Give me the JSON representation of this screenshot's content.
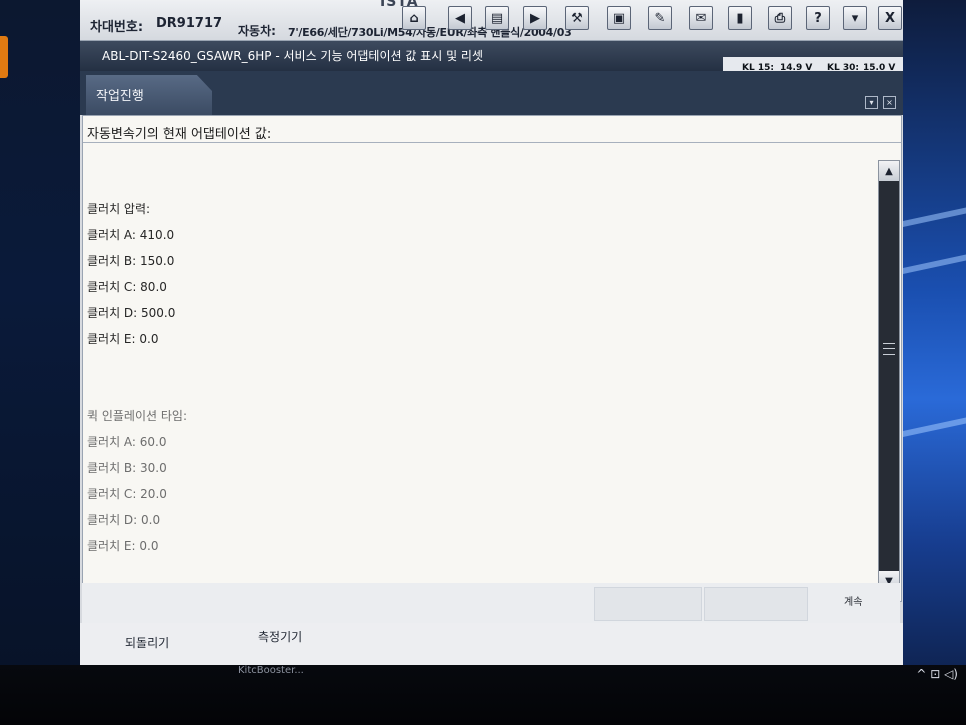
{
  "app": {
    "logo_partial": "ISTA"
  },
  "vehicle": {
    "vin_label": "차대번호:",
    "vin_value": "DR91717",
    "car_label": "자동차:",
    "car_value": "7'/E66/세단/730Li/M54/자동/EUR/좌측 핸들식/2004/03"
  },
  "toolbar": {
    "icons": [
      "home-icon",
      "arrow-left-icon",
      "document-icon",
      "arrow-right-icon",
      "wrench-icon",
      "car-check-icon",
      "pen-icon",
      "mail-icon",
      "battery-icon",
      "print-icon",
      "help-icon",
      "minimize-icon",
      "close-icon"
    ],
    "help_label": "?",
    "close_label": "X"
  },
  "subheader": {
    "title": "ABL-DIT-S2460_GSAWR_6HP  -  서비스 기능 어댑테이션 값 표시 및 리셋",
    "kl15_label": "KL 15:",
    "kl15_value": "14.9 V",
    "kl30_label": "KL 30:",
    "kl30_value": "15.0 V"
  },
  "tab": {
    "label": "작업진행"
  },
  "content": {
    "intro": "자동변속기의 현재 어댑테이션 값:",
    "pressure_heading": "클러치 압력:",
    "pressure": [
      "클러치 A: 410.0",
      "클러치 B: 150.0",
      "클러치 C: 80.0",
      "클러치 D: 500.0",
      "클러치 E: 0.0"
    ],
    "fast_heading": "퀵 인플레이션 타임:",
    "fast": [
      "클러치 A: 60.0",
      "클러치 B: 30.0",
      "클러치 C: 20.0",
      "클러치 D: 0.0",
      "클러치 E: 0.0"
    ]
  },
  "actions": {
    "continue_label": "계속"
  },
  "footer": {
    "back_label": "되돌리기",
    "measure_label": "측정기기"
  },
  "taskbar": {
    "label": "KitcBooster...",
    "tray": "^ ⊡ ◁)"
  }
}
